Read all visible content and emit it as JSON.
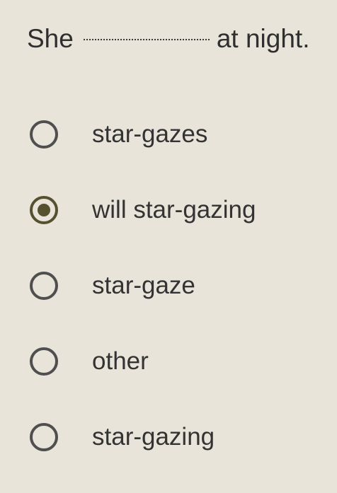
{
  "question": {
    "before": "She",
    "after": "at night."
  },
  "options": [
    {
      "label": "star-gazes",
      "selected": false
    },
    {
      "label": "will star-gazing",
      "selected": true
    },
    {
      "label": "star-gaze",
      "selected": false
    },
    {
      "label": "other",
      "selected": false
    },
    {
      "label": "star-gazing",
      "selected": false
    }
  ],
  "colors": {
    "background": "#e8e4da",
    "text": "#2f2f2f",
    "radio_border": "#4f4f4f",
    "radio_selected": "#55512f"
  }
}
